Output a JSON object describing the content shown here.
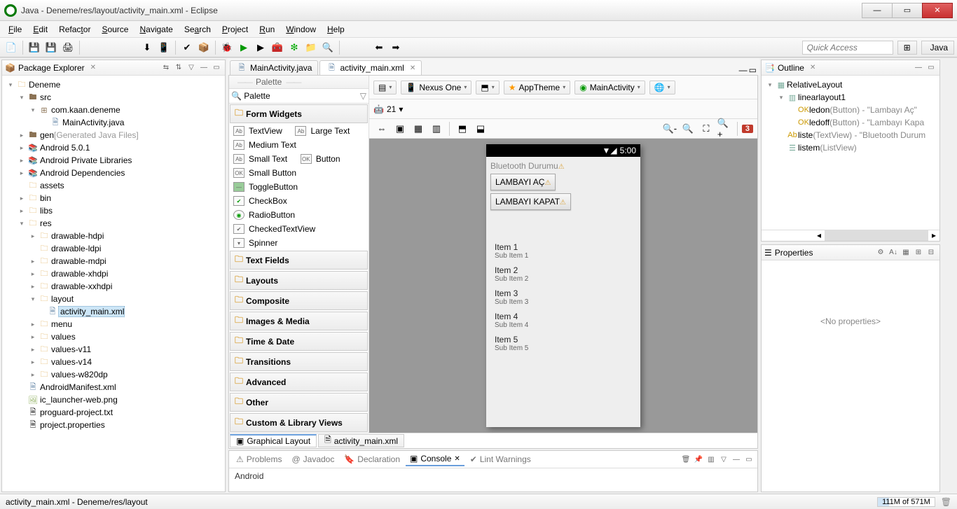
{
  "window": {
    "title": "Java - Deneme/res/layout/activity_main.xml - Eclipse"
  },
  "menu": [
    "File",
    "Edit",
    "Refactor",
    "Source",
    "Navigate",
    "Search",
    "Project",
    "Run",
    "Window",
    "Help"
  ],
  "quick_access": "Quick Access",
  "perspective": "Java",
  "pkg_explorer": {
    "title": "Package Explorer",
    "tree": {
      "project": "Deneme",
      "src": "src",
      "pkg": "com.kaan.deneme",
      "mainact": "MainActivity.java",
      "gen": "gen",
      "gen_note": "[Generated Java Files]",
      "android501": "Android 5.0.1",
      "apl": "Android Private Libraries",
      "adeps": "Android Dependencies",
      "assets": "assets",
      "bin": "bin",
      "libs": "libs",
      "res": "res",
      "dhdpi": "drawable-hdpi",
      "dldpi": "drawable-ldpi",
      "dmdpi": "drawable-mdpi",
      "dxhdpi": "drawable-xhdpi",
      "dxxhdpi": "drawable-xxhdpi",
      "layout": "layout",
      "activity_main": "activity_main.xml",
      "menu_f": "menu",
      "values": "values",
      "values11": "values-v11",
      "values14": "values-v14",
      "valuesw": "values-w820dp",
      "manifest": "AndroidManifest.xml",
      "iclauncher": "ic_launcher-web.png",
      "proguard": "proguard-project.txt",
      "projprop": "project.properties"
    }
  },
  "editor": {
    "tab_inactive": "MainActivity.java",
    "tab_active": "activity_main.xml",
    "palette_title": "Palette",
    "cats": {
      "formwidgets": "Form Widgets",
      "textfields": "Text Fields",
      "layouts": "Layouts",
      "composite": "Composite",
      "images": "Images & Media",
      "timedate": "Time & Date",
      "transitions": "Transitions",
      "advanced": "Advanced",
      "other": "Other",
      "custom": "Custom & Library Views"
    },
    "widgets": {
      "textview": "TextView",
      "largetext": "Large Text",
      "mediumtext": "Medium Text",
      "smalltext": "Small Text",
      "button": "Button",
      "smallbutton": "Small Button",
      "togglebutton": "ToggleButton",
      "checkbox": "CheckBox",
      "radiobutton": "RadioButton",
      "checkedtextview": "CheckedTextView",
      "spinner": "Spinner"
    },
    "cfg": {
      "device": "Nexus One",
      "theme": "AppTheme",
      "activity": "MainActivity",
      "api": "21"
    },
    "errors": "3",
    "gl_tab": "Graphical Layout",
    "xml_tab": "activity_main.xml"
  },
  "android_preview": {
    "time": "5:00",
    "btlabel": "Bluetooth Durumu",
    "btn_on": "LAMBAYI AÇ",
    "btn_off": "LAMBAYI KAPAT",
    "items": [
      {
        "t": "Item 1",
        "s": "Sub Item 1"
      },
      {
        "t": "Item 2",
        "s": "Sub Item 2"
      },
      {
        "t": "Item 3",
        "s": "Sub Item 3"
      },
      {
        "t": "Item 4",
        "s": "Sub Item 4"
      },
      {
        "t": "Item 5",
        "s": "Sub Item 5"
      }
    ]
  },
  "outline": {
    "title": "Outline",
    "root": "RelativeLayout",
    "ll": "linearlayout1",
    "ledon": "ledon",
    "ledon_d": "(Button) - \"Lambayı Aç\"",
    "ledoff": "ledoff",
    "ledoff_d": "(Button) - \"Lambayı Kapa",
    "liste": "liste",
    "liste_d": "(TextView) - \"Bluetooth Durum",
    "listem": "listem",
    "listem_d": "(ListView)"
  },
  "properties": {
    "title": "Properties",
    "empty": "<No properties>"
  },
  "bottom": {
    "problems": "Problems",
    "javadoc": "Javadoc",
    "declaration": "Declaration",
    "console": "Console",
    "lint": "Lint Warnings",
    "body": "Android"
  },
  "status": {
    "path": "activity_main.xml - Deneme/res/layout",
    "mem": "111M of 571M"
  }
}
